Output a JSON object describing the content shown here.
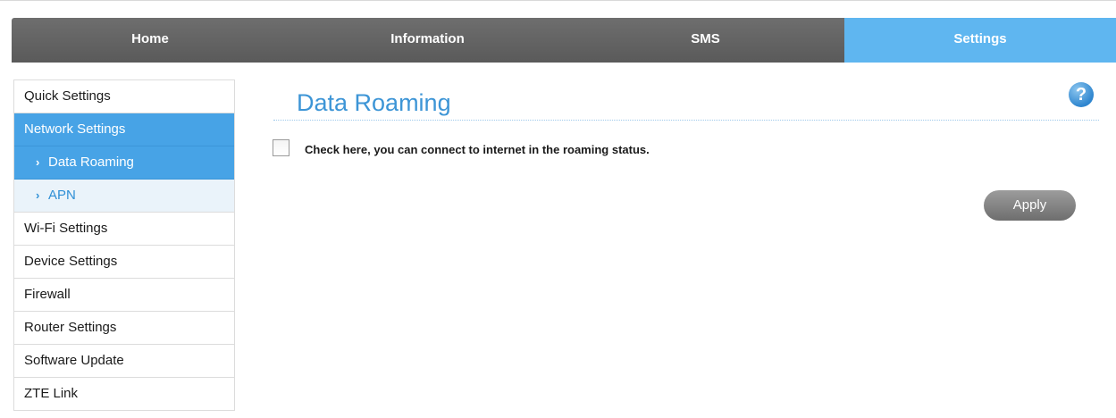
{
  "topnav": {
    "tabs": [
      {
        "label": "Home"
      },
      {
        "label": "Information"
      },
      {
        "label": "SMS"
      },
      {
        "label": "Settings",
        "active": true
      }
    ],
    "active_color": "#5fb6f0",
    "bar_color": "#626262"
  },
  "sidebar": {
    "items": [
      {
        "label": "Quick Settings"
      },
      {
        "label": "Network Settings",
        "active": true
      },
      {
        "label": "Data Roaming",
        "sub": true,
        "active": true
      },
      {
        "label": "APN",
        "sub": true
      },
      {
        "label": "Wi-Fi Settings"
      },
      {
        "label": "Device Settings"
      },
      {
        "label": "Firewall"
      },
      {
        "label": "Router Settings"
      },
      {
        "label": "Software Update"
      },
      {
        "label": "ZTE Link"
      }
    ],
    "sub_marker": "›",
    "active_color": "#47a3e6"
  },
  "main": {
    "title": "Data Roaming",
    "help_icon": "?",
    "roaming_checkbox": {
      "label": "Check here, you can connect to internet in the roaming status.",
      "checked": false
    },
    "apply_label": "Apply"
  }
}
